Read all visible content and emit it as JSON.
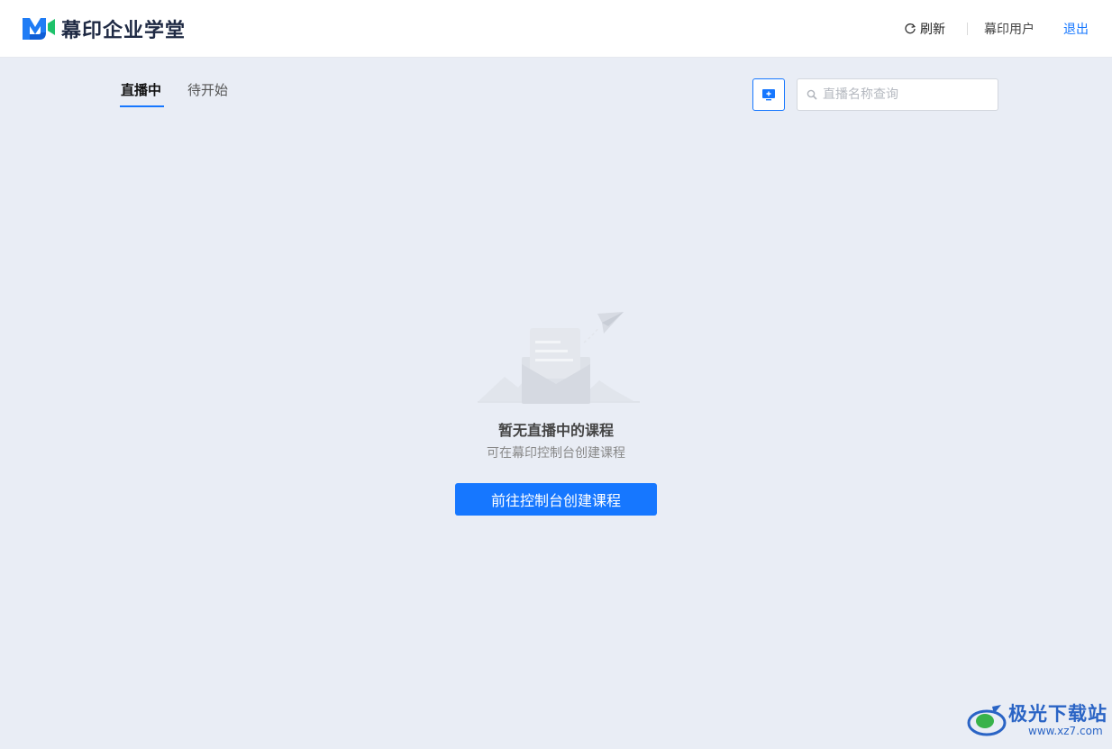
{
  "app": {
    "logo_text": "幕印企业学堂"
  },
  "header": {
    "refresh_label": "刷新",
    "username": "幕印用户",
    "logout_label": "退出"
  },
  "tabs": [
    {
      "label": "直播中",
      "active": true
    },
    {
      "label": "待开始",
      "active": false
    }
  ],
  "toolbar": {
    "add_icon": "monitor-plus-icon",
    "search_placeholder": "直播名称查询",
    "search_value": ""
  },
  "empty_state": {
    "title": "暂无直播中的课程",
    "subtitle": "可在幕印控制台创建课程",
    "button_label": "前往控制台创建课程"
  },
  "watermark": {
    "title": "极光下载站",
    "url": "www.xz7.com"
  },
  "colors": {
    "accent": "#1677ff",
    "background": "#e9edf5",
    "header_bg": "#ffffff"
  }
}
